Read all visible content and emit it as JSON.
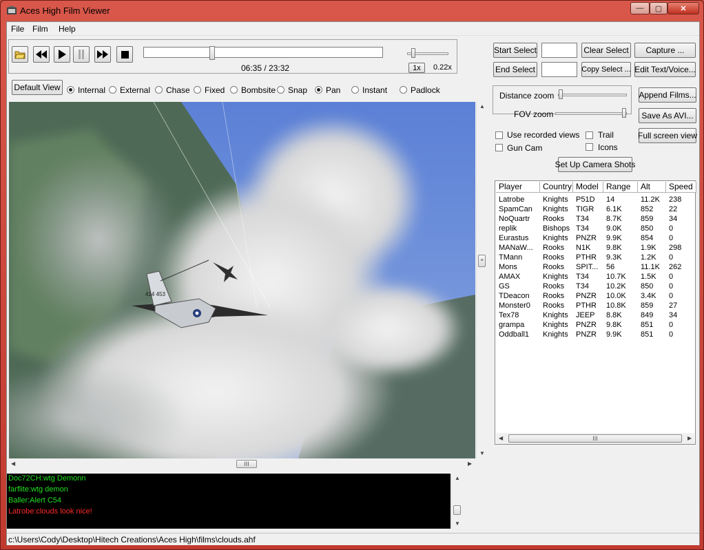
{
  "window": {
    "title": "Aces High Film Viewer",
    "minimize": "—",
    "maximize": "▢",
    "close": "✕"
  },
  "menu": [
    {
      "label": "File"
    },
    {
      "label": "Film"
    },
    {
      "label": "Help"
    }
  ],
  "playback": {
    "time": "06:35 / 23:32",
    "progress": 0.28,
    "speed_label": "1x",
    "speed_value": "0.22x",
    "speed_slider": 0.1
  },
  "selection": {
    "start_select": "Start Select",
    "end_select": "End Select",
    "start_value": "",
    "end_value": "",
    "clear_select": "Clear Select",
    "copy_select": "Copy Select ...",
    "capture": "Capture ...",
    "edit_text_voice": "Edit Text/Voice..."
  },
  "views": {
    "default_view": "Default View",
    "options": [
      {
        "label": "Internal",
        "selected": true
      },
      {
        "label": "External",
        "selected": false
      },
      {
        "label": "Chase",
        "selected": false
      },
      {
        "label": "Fixed",
        "selected": false
      },
      {
        "label": "Bombsite",
        "selected": false
      },
      {
        "label": "Snap",
        "selected": false
      },
      {
        "label": "Pan",
        "selected": true
      },
      {
        "label": "Instant",
        "selected": false
      },
      {
        "label": "Padlock",
        "selected": false
      }
    ]
  },
  "camera": {
    "distance_zoom": "Distance zoom",
    "distance_zoom_value": 0.0,
    "fov_zoom": "FOV zoom",
    "fov_zoom_value": 1.0,
    "use_recorded_views": "Use recorded views",
    "gun_cam": "Gun Cam",
    "trail": "Trail",
    "icons": "Icons",
    "set_up_camera_shots": "Set Up Camera Shots",
    "append_films": "Append Films...",
    "save_as_avi": "Save As AVI...",
    "full_screen_view": "Full screen view"
  },
  "scene": {
    "aircraft_marking": "414 453"
  },
  "players": {
    "columns": [
      "Player",
      "Country",
      "Model",
      "Range",
      "Alt",
      "Speed"
    ],
    "rows": [
      [
        "Latrobe",
        "Knights",
        "P51D",
        "14",
        "11.2K",
        "238"
      ],
      [
        "SpamCan",
        "Knights",
        "TIGR",
        "6.1K",
        "852",
        "22"
      ],
      [
        "NoQuartr",
        "Rooks",
        "T34",
        "8.7K",
        "859",
        "34"
      ],
      [
        "replik",
        "Bishops",
        "T34",
        "9.0K",
        "850",
        "0"
      ],
      [
        "Eurastus",
        "Knights",
        "PNZR",
        "9.9K",
        "854",
        "0"
      ],
      [
        "MANaW...",
        "Rooks",
        "N1K",
        "9.8K",
        "1.9K",
        "298"
      ],
      [
        "TMann",
        "Rooks",
        "PTHR",
        "9.3K",
        "1.2K",
        "0"
      ],
      [
        "Mons",
        "Rooks",
        "SPIT...",
        "56",
        "11.1K",
        "262"
      ],
      [
        "AMAX",
        "Knights",
        "T34",
        "10.7K",
        "1.5K",
        "0"
      ],
      [
        "GS",
        "Rooks",
        "T34",
        "10.2K",
        "850",
        "0"
      ],
      [
        "TDeacon",
        "Rooks",
        "PNZR",
        "10.0K",
        "3.4K",
        "0"
      ],
      [
        "Monster0",
        "Rooks",
        "PTHR",
        "10.8K",
        "859",
        "27"
      ],
      [
        "Tex78",
        "Knights",
        "JEEP",
        "8.8K",
        "849",
        "34"
      ],
      [
        "grampa",
        "Knights",
        "PNZR",
        "9.8K",
        "851",
        "0"
      ],
      [
        "Oddball1",
        "Knights",
        "PNZR",
        "9.9K",
        "851",
        "0"
      ]
    ]
  },
  "chat": [
    {
      "text": "Doc72CH:wtg Demonn",
      "color": "#22e022"
    },
    {
      "text": "farflite:wtg demon",
      "color": "#22e022"
    },
    {
      "text": "Baller:Alert C54",
      "color": "#22e022"
    },
    {
      "text": "Latrobe:clouds look nice!",
      "color": "#ff2a2a"
    }
  ],
  "status": {
    "path": "c:\\Users\\Cody\\Desktop\\Hitech Creations\\Aces High\\films\\clouds.ahf"
  },
  "scroll": {
    "grip": "III"
  }
}
